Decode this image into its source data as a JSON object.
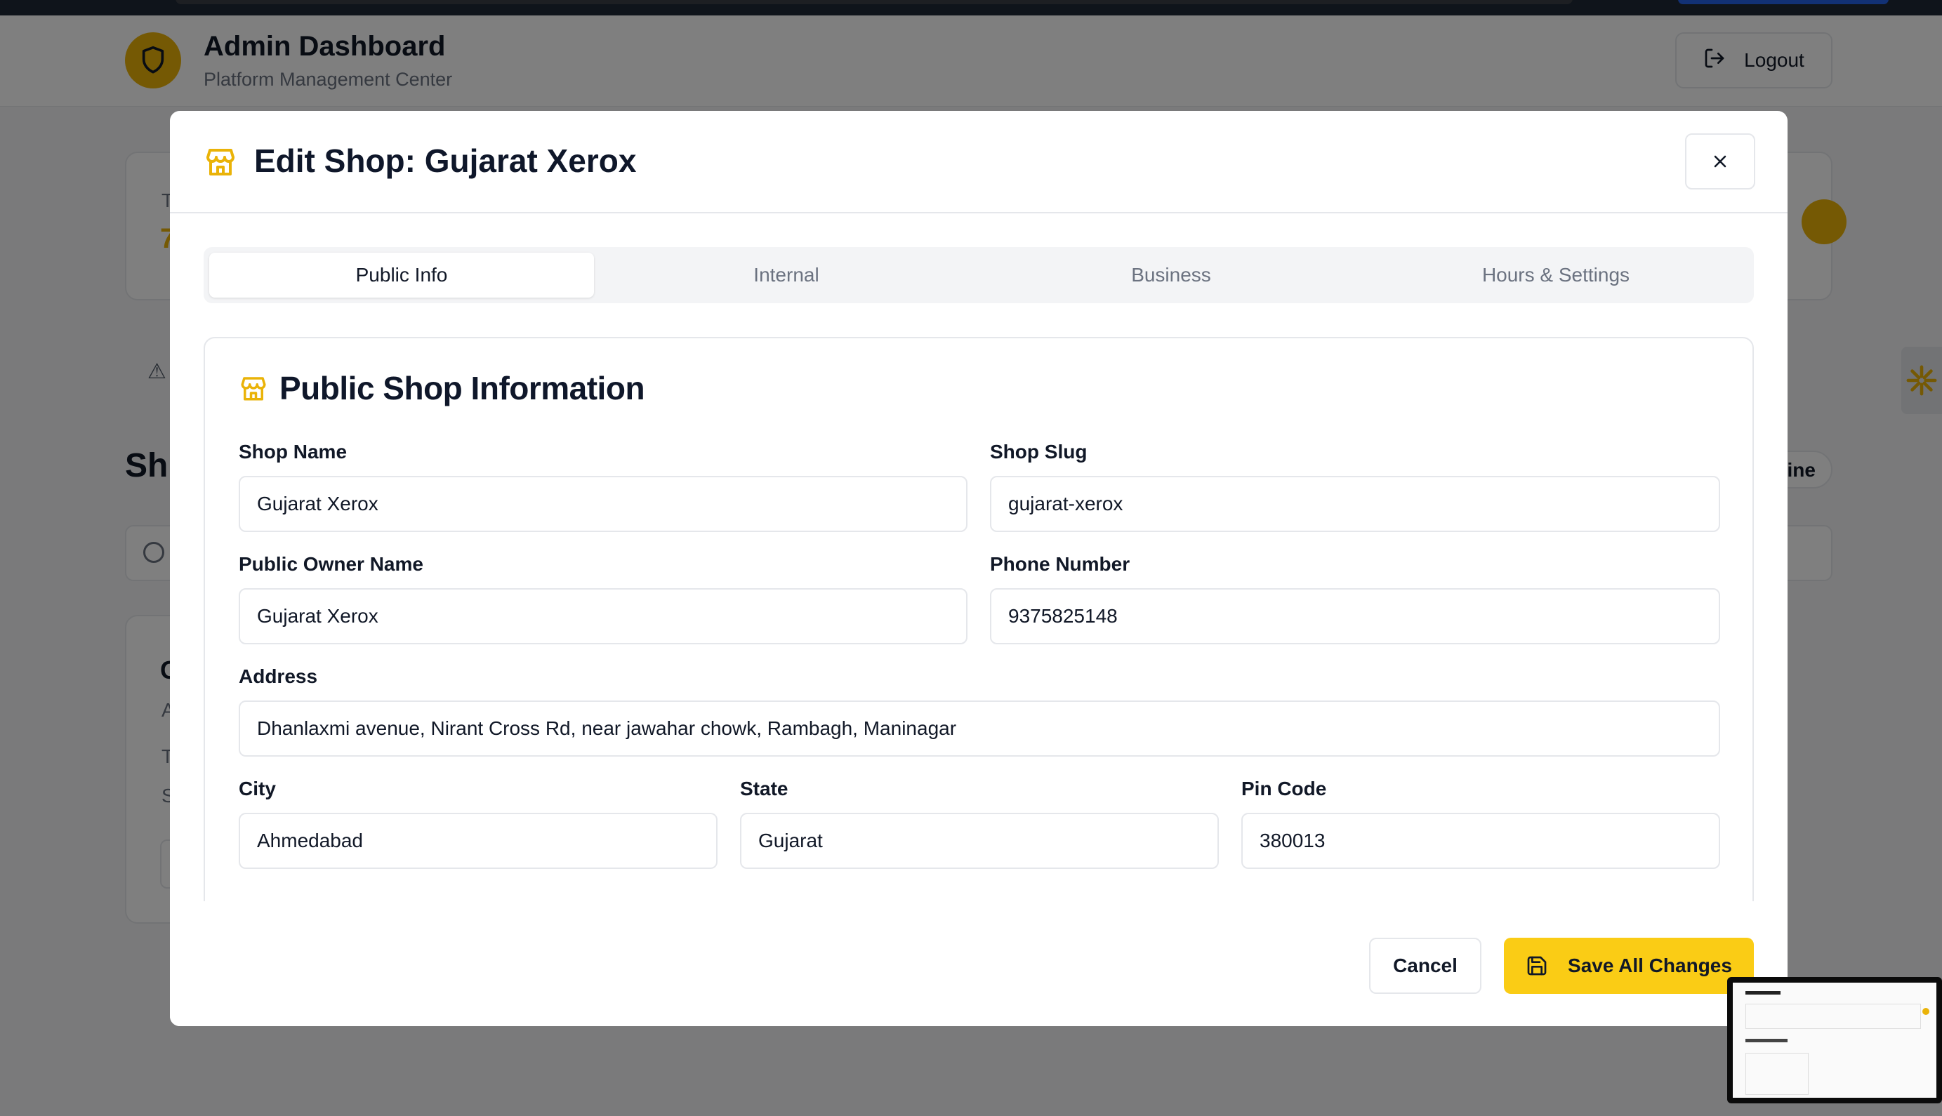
{
  "app": {
    "title": "Admin Dashboard",
    "subtitle": "Platform Management Center",
    "logout_label": "Logout"
  },
  "background": {
    "card_initial": "T",
    "card_value": "7",
    "section_heading": "Sh",
    "chip_label": "ine",
    "card2_title": "G",
    "card2_line1": "A",
    "card2_line2": "T",
    "card2_line3": "S"
  },
  "modal": {
    "title": "Edit Shop: Gujarat Xerox",
    "tabs": [
      {
        "label": "Public Info",
        "active": true
      },
      {
        "label": "Internal",
        "active": false
      },
      {
        "label": "Business",
        "active": false
      },
      {
        "label": "Hours & Settings",
        "active": false
      }
    ],
    "section_title": "Public Shop Information",
    "fields": {
      "shop_name": {
        "label": "Shop Name",
        "value": "Gujarat Xerox"
      },
      "shop_slug": {
        "label": "Shop Slug",
        "value": "gujarat-xerox"
      },
      "owner_name": {
        "label": "Public Owner Name",
        "value": "Gujarat Xerox"
      },
      "phone": {
        "label": "Phone Number",
        "value": "9375825148"
      },
      "address": {
        "label": "Address",
        "value": "Dhanlaxmi avenue, Nirant Cross Rd, near jawahar chowk, Rambagh, Maninagar"
      },
      "city": {
        "label": "City",
        "value": "Ahmedabad"
      },
      "state": {
        "label": "State",
        "value": "Gujarat"
      },
      "pin": {
        "label": "Pin Code",
        "value": "380013"
      }
    },
    "cancel_label": "Cancel",
    "save_label": "Save All Changes"
  },
  "colors": {
    "accent": "#facc15",
    "icon_accent": "#eab308",
    "border": "#e5e7eb"
  }
}
